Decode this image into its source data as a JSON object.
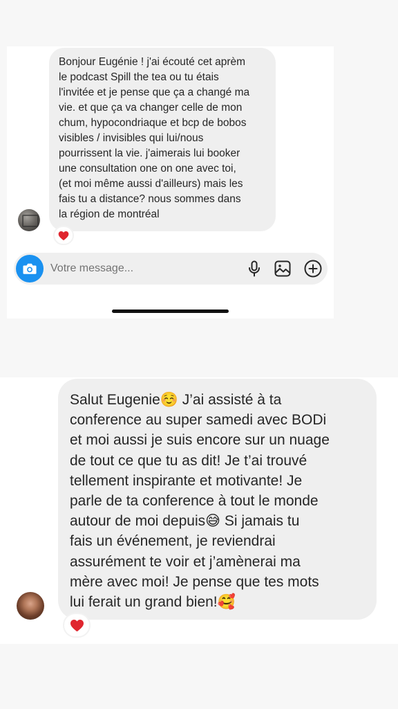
{
  "screenshot_1": {
    "message": {
      "text": "Bonjour Eugénie ! j'ai écouté cet aprèm\nle podcast Spill the tea ou tu étais\nl'invitée et je pense que ça a changé ma\nvie. et que ça va changer celle de mon\nchum, hypocondriaque et bcp de bobos\nvisibles / invisibles qui lui/nous\npourrissent la vie. j'aimerais lui booker\nune consultation one on one avec toi,\n(et moi même aussi d'ailleurs) mais les\nfais tu a distance? nous sommes dans\nla région de montréal",
      "reaction": "heart"
    },
    "composer": {
      "placeholder": "Votre message...",
      "icons": [
        "camera-icon",
        "microphone-icon",
        "image-icon",
        "plus-circle-icon"
      ]
    }
  },
  "screenshot_2": {
    "message": {
      "text": "Salut Eugenie☺️  J’ai assisté à ta\nconference au super samedi avec BODi\net moi aussi je suis encore sur un nuage\nde tout ce que tu as dit! Je t’ai trouvé\ntellement inspirante et motivante! Je\nparle de ta conference à tout le monde\nautour de moi depuis😅  Si jamais tu\nfais un événement, je reviendrai\nassurément te voir et j’amènerai ma\nmère avec moi! Je pense que tes mots\nlui ferait un grand bien!🥰",
      "reaction": "heart"
    }
  },
  "colors": {
    "bubble": "#efefef",
    "accent": "#1a91f0",
    "heart": "#e0262f"
  }
}
